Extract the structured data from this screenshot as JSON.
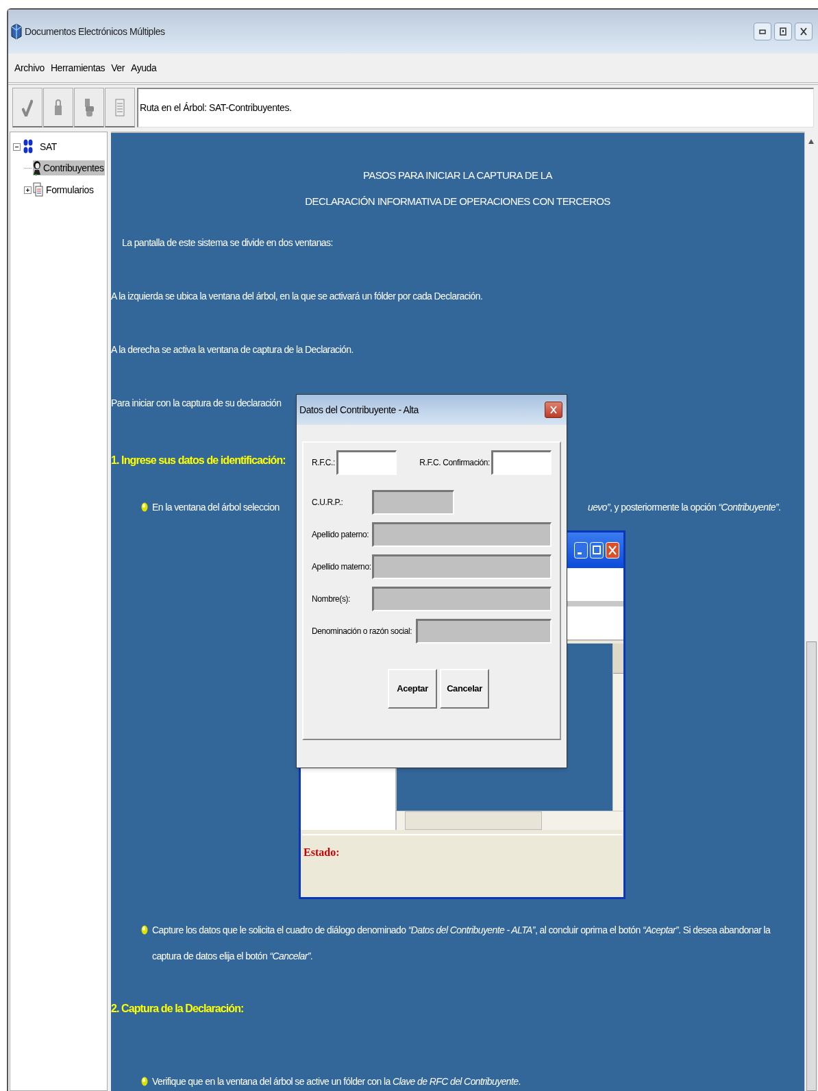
{
  "window": {
    "title": "Documentos Electrónicos Múltiples"
  },
  "menu": [
    "Archivo",
    "Herramientas",
    "Ver",
    "Ayuda"
  ],
  "toolbar": {
    "path": "Ruta en el Árbol: SAT-Contribuyentes."
  },
  "tree": [
    {
      "label": "SAT",
      "expanded": true,
      "selected": false,
      "children": [
        {
          "label": "Contribuyentes",
          "selected": true
        },
        {
          "label": "Formularios",
          "expanded": false,
          "selected": false
        }
      ]
    }
  ],
  "content": {
    "title_lines": [
      "PASOS PARA INICIAR LA CAPTURA DE LA",
      "DECLARACIÓN INFORMATIVA DE OPERACIONES CON TERCEROS"
    ],
    "intro": [
      "La pantalla de este sistema se divide en dos ventanas:",
      "A la izquierda se ubica la ventana del árbol, en la que se activará un fólder por cada Declaración.",
      "A la derecha se activa la ventana de captura de la Declaración.",
      "Para iniciar con la captura de su declaración"
    ],
    "step_1": {
      "title": "1. Ingrese sus datos de identificación:",
      "bullet_left": "En la ventana del árbol seleccion",
      "bullet_right": "*uevo”*, y posteriormente la opción *“Contribuyente”*.",
      "note": "Capture los datos que le solicita el cuadro de diálogo denominado *“Datos del Contribuyente - ALTA”*, al concluir oprima el botón *“Aceptar”*. Si desea abandonar la captura de datos elija el botón *“Cancelar”*."
    },
    "embedded_window": {
      "status_label": "Estado:"
    },
    "step_2": {
      "title": "2. Captura de la Declaración:",
      "bullet": "Verifique que en la ventana del árbol se active un fólder con la *Clave de RFC del Contribuyente*."
    }
  },
  "dialog": {
    "title": "Datos del Contribuyente - Alta",
    "fields": [
      {
        "label": "R.F.C.:",
        "disabled": false
      },
      {
        "label": "R.F.C. Confirmación:",
        "disabled": false
      },
      {
        "label": "C.U.R.P.:",
        "disabled": true
      },
      {
        "label": "Apellido paterno:",
        "disabled": true
      },
      {
        "label": "Apellido materno:",
        "disabled": true
      },
      {
        "label": "Nombre(s):",
        "disabled": true
      },
      {
        "label": "Denominación o razón social:",
        "disabled": true
      }
    ],
    "buttons": [
      "Aceptar",
      "Cancelar"
    ]
  }
}
